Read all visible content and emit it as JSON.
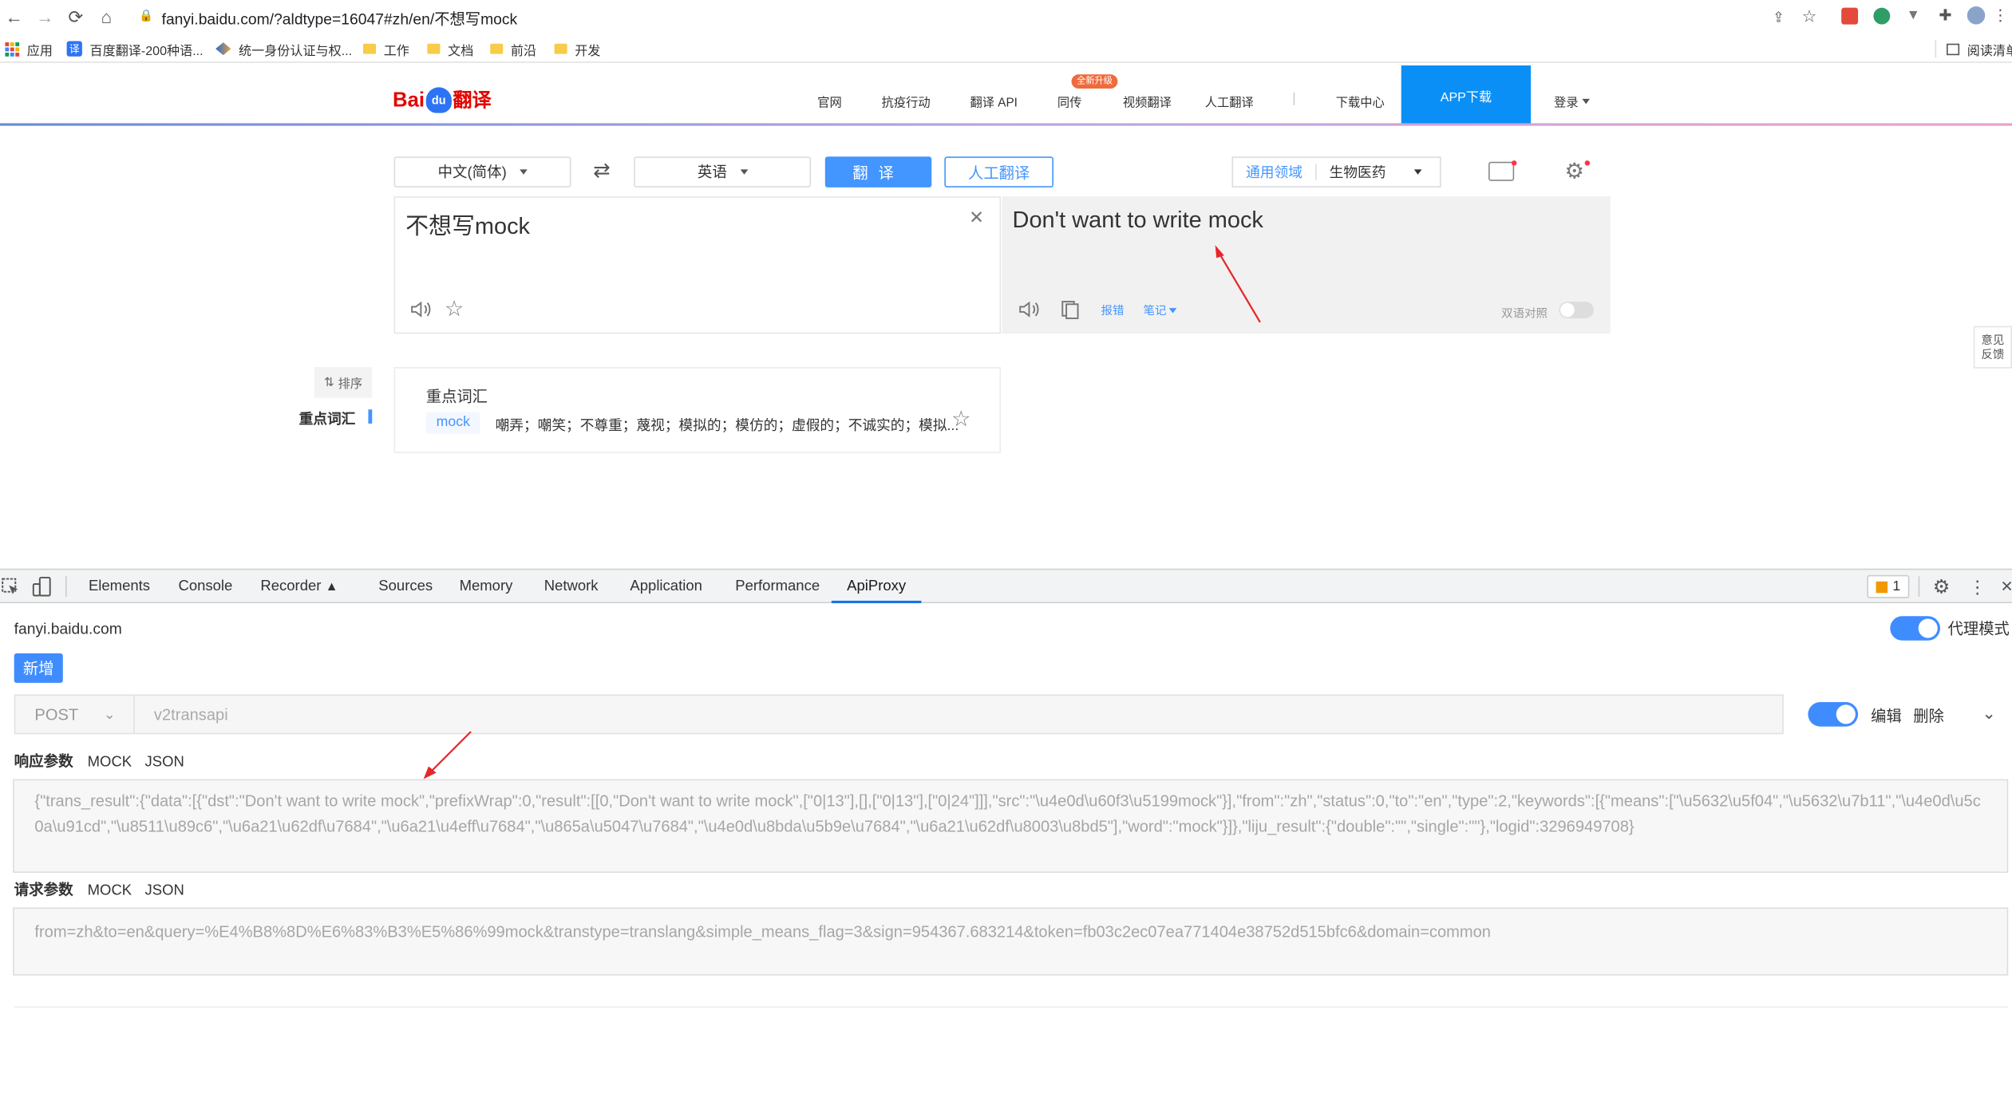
{
  "browser": {
    "url": "fanyi.baidu.com/?aldtype=16047#zh/en/不想写mock",
    "bookmarks": [
      "应用",
      "百度翻译-200种语...",
      "统一身份认证与权...",
      "工作",
      "文档",
      "前沿",
      "开发"
    ],
    "reading_list": "阅读清单"
  },
  "baidu": {
    "logo_bai": "Bai",
    "logo_du": "du",
    "logo_fanyi": "翻译",
    "nav": [
      "官网",
      "抗疫行动",
      "翻译 API",
      "同传",
      "视频翻译",
      "人工翻译",
      "下载中心"
    ],
    "new_badge": "全新升级",
    "app_download": "APP下载",
    "login": "登录",
    "source_lang": "中文(简体)",
    "target_lang": "英语",
    "translate_btn": "翻译",
    "human_translate": "人工翻译",
    "domain_label": "通用领域",
    "domain_value": "生物医药",
    "source_text": "不想写mock",
    "target_text": "Don't want to write mock",
    "error_report": "报错",
    "notes": "笔记",
    "bilingual": "双语对照",
    "sort": "排序",
    "key_vocab_side": "重点词汇",
    "key_vocab_title": "重点词汇",
    "keyword": "mock",
    "keyword_means": "嘲弄；嘲笑；不尊重；蔑视；模拟的；模仿的；虚假的；不诚实的；模拟...",
    "feedback": [
      "意见",
      "反馈"
    ]
  },
  "devtools": {
    "tabs": [
      "Elements",
      "Console",
      "Recorder",
      "Sources",
      "Memory",
      "Network",
      "Application",
      "Performance",
      "ApiProxy"
    ],
    "active_tab": "ApiProxy",
    "issue_count": "1",
    "host": "fanyi.baidu.com",
    "proxy_mode": "代理模式",
    "new_btn": "新增",
    "method": "POST",
    "api_path": "v2transapi",
    "edit": "编辑",
    "delete": "删除",
    "response_label": "响应参数",
    "request_label": "请求参数",
    "mock": "MOCK",
    "json": "JSON",
    "response_body": "{\"trans_result\":{\"data\":[{\"dst\":\"Don't want to write mock\",\"prefixWrap\":0,\"result\":[[0,\"Don't want to write mock\",[\"0|13\"],[],[\"0|13\"],[\"0|24\"]]],\"src\":\"\\u4e0d\\u60f3\\u5199mock\"}],\"from\":\"zh\",\"status\":0,\"to\":\"en\",\"type\":2,\"keywords\":[{\"means\":[\"\\u5632\\u5f04\",\"\\u5632\\u7b11\",\"\\u4e0d\\u5c0a\\u91cd\",\"\\u8511\\u89c6\",\"\\u6a21\\u62df\\u7684\",\"\\u6a21\\u4eff\\u7684\",\"\\u865a\\u5047\\u7684\",\"\\u4e0d\\u8bda\\u5b9e\\u7684\",\"\\u6a21\\u62df\\u8003\\u8bd5\"],\"word\":\"mock\"}]},\"liju_result\":{\"double\":\"\",\"single\":\"\"},\"logid\":3296949708}",
    "request_body": "from=zh&to=en&query=%E4%B8%8D%E6%83%B3%E5%86%99mock&transtype=translang&simple_means_flag=3&sign=954367.683214&token=fb03c2ec07ea771404e38752d515bfc6&domain=common"
  },
  "colors": {
    "accent": "#3f8cff",
    "baidu_blue": "#4395ff",
    "annotation_red": "#e8262a"
  }
}
